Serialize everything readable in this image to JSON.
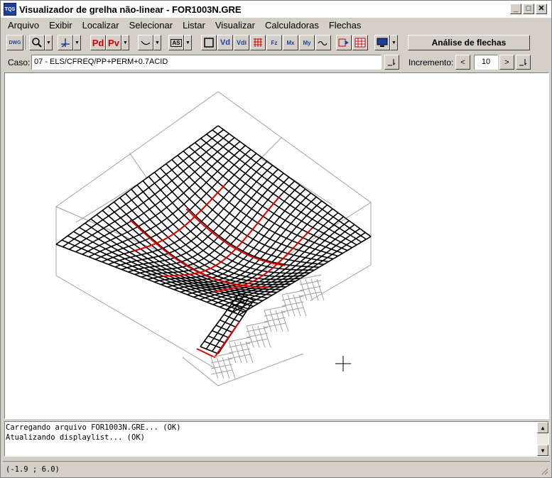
{
  "window": {
    "title": "Visualizador de grelha não-linear - FOR1003N.GRE",
    "app_icon_text": "TQS"
  },
  "menu": [
    "Arquivo",
    "Exibir",
    "Localizar",
    "Selecionar",
    "Listar",
    "Visualizar",
    "Calculadoras",
    "Flechas"
  ],
  "toolbar": {
    "dwg_label": "DWG",
    "pd_label": "Pd",
    "pv_label": "Pv",
    "as_label": "AS",
    "vd_label": "Vd",
    "vdi_label": "Vdi",
    "fz_label": "Fz",
    "mx_label": "Mx",
    "my_label": "My",
    "analysis_button": "Análise de flechas"
  },
  "case": {
    "label": "Caso:",
    "value": "07 - ELS/CFREQ/PP+PERM+0.7ACID"
  },
  "increment": {
    "label": "Incremento:",
    "value": "10",
    "prev": "<",
    "next": ">"
  },
  "console": {
    "lines": [
      "Carregando arquivo FOR1003N.GRE... (OK)",
      "Atualizando displaylist... (OK)"
    ]
  },
  "status": {
    "coords": "(-1.9 ; 6.0)"
  }
}
